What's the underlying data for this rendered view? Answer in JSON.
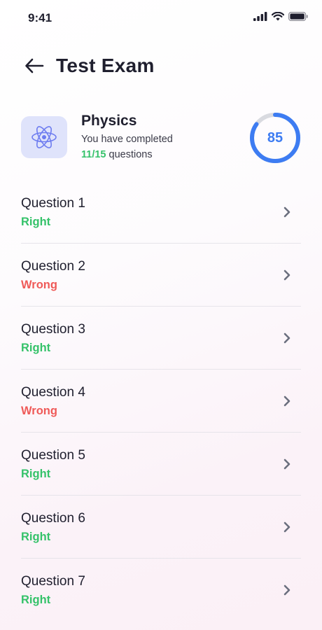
{
  "status_bar": {
    "time": "9:41",
    "icons": [
      "signal-icon",
      "wifi-icon",
      "battery-icon"
    ]
  },
  "header": {
    "back_icon": "arrow-left-icon",
    "title": "Test Exam"
  },
  "subject": {
    "icon": "atom-icon",
    "name": "Physics",
    "subtitle": "You have completed",
    "completed": "11/15",
    "completed_suffix": " questions",
    "score": "85",
    "score_fraction": 0.85
  },
  "colors": {
    "right": "#35c26a",
    "wrong": "#ef5a58",
    "accent": "#3d7cf2",
    "icon_bg": "#dfe3fb"
  },
  "questions": [
    {
      "title": "Question 1",
      "status": "Right"
    },
    {
      "title": "Question 2",
      "status": "Wrong"
    },
    {
      "title": "Question 3",
      "status": "Right"
    },
    {
      "title": "Question 4",
      "status": "Wrong"
    },
    {
      "title": "Question 5",
      "status": "Right"
    },
    {
      "title": "Question 6",
      "status": "Right"
    },
    {
      "title": "Question 7",
      "status": "Right"
    }
  ]
}
